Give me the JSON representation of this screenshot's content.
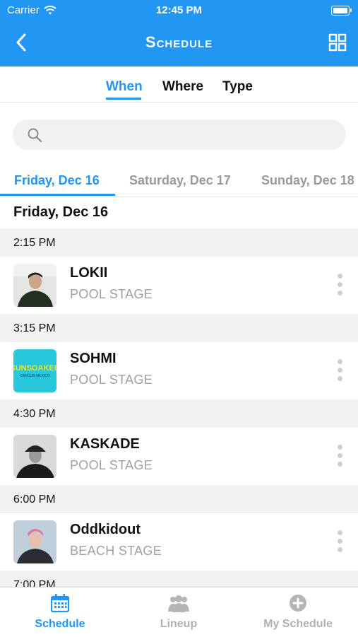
{
  "status_bar": {
    "carrier": "Carrier",
    "time": "12:45 PM"
  },
  "nav": {
    "title": "Schedule"
  },
  "filters": [
    "When",
    "Where",
    "Type"
  ],
  "search": {
    "placeholder": ""
  },
  "day_tabs": [
    "Friday, Dec 16",
    "Saturday, Dec 17",
    "Sunday, Dec 18"
  ],
  "section_title": "Friday, Dec 16",
  "schedule": [
    {
      "time": "2:15 PM",
      "artist": "LOKII",
      "stage": "POOL STAGE"
    },
    {
      "time": "3:15 PM",
      "artist": "SOHMI",
      "stage": "POOL STAGE"
    },
    {
      "time": "4:30 PM",
      "artist": "KASKADE",
      "stage": "POOL STAGE"
    },
    {
      "time": "6:00 PM",
      "artist": "Oddkidout",
      "stage": "BEACH STAGE"
    },
    {
      "time": "7:00 PM",
      "artist": "",
      "stage": ""
    }
  ],
  "thumb_text": {
    "sohmi_line1": "SUNSOAKED",
    "sohmi_line2": "CANCUN MEXICO"
  },
  "tab_bar": [
    "Schedule",
    "Lineup",
    "My Schedule"
  ],
  "colors": {
    "accent": "#2196f3",
    "muted": "#a0a0a0",
    "separator": "#f1f1f1"
  }
}
